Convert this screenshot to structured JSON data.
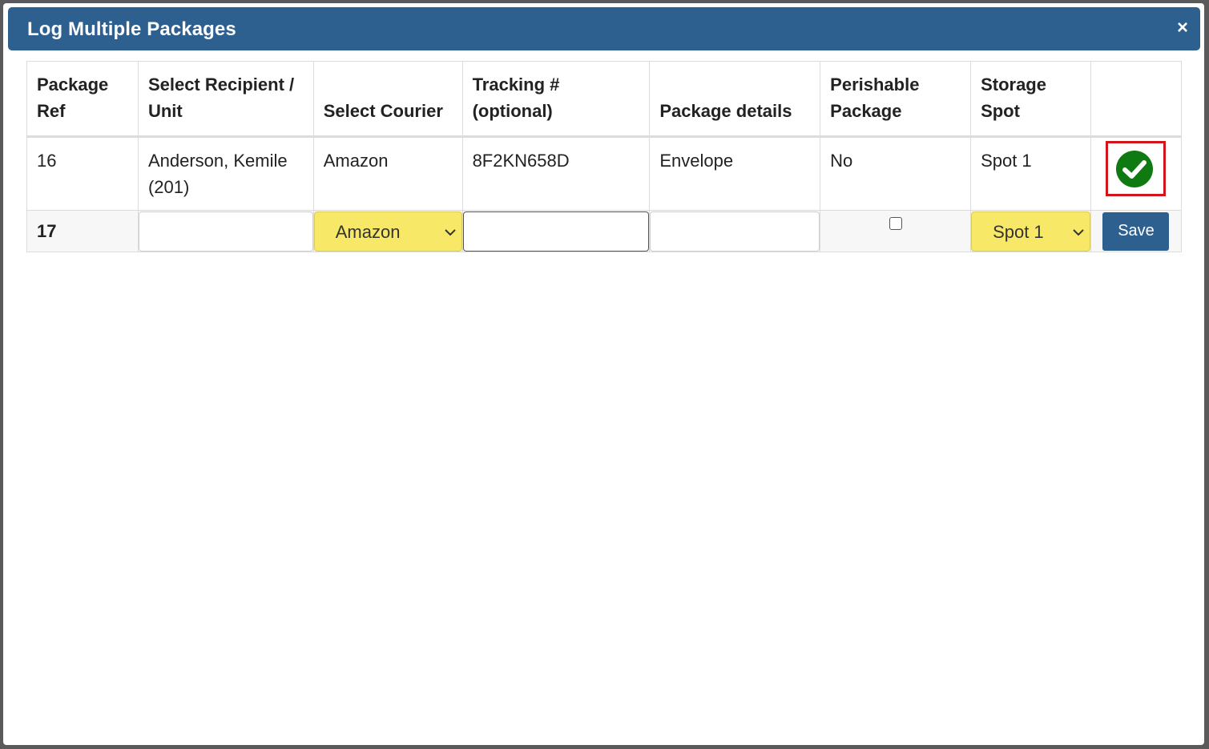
{
  "dialog": {
    "title": "Log Multiple Packages",
    "close_symbol": "×"
  },
  "table": {
    "headers": {
      "ref": "Package Ref",
      "recipient": "Select Recipient / Unit",
      "courier": "Select Courier",
      "tracking": "Tracking # (optional)",
      "details": "Package details",
      "perishable": "Perishable Package",
      "storage": "Storage Spot",
      "action": ""
    },
    "logged_row": {
      "ref": "16",
      "recipient": "Anderson, Kemile (201)",
      "courier": "Amazon",
      "tracking": "8F2KN658D",
      "details": "Envelope",
      "perishable": "No",
      "storage": "Spot 1",
      "status_icon": "check-circle-icon"
    },
    "entry_row": {
      "ref": "17",
      "recipient_value": "",
      "courier_selected": "Amazon",
      "tracking_value": "",
      "details_value": "",
      "perishable_checked": false,
      "storage_selected": "Spot 1",
      "save_label": "Save"
    }
  },
  "colors": {
    "header_bg": "#2d5f8f",
    "select_bg": "#f7e967",
    "success_green": "#0f7a12",
    "highlight_red": "#d0161b"
  }
}
